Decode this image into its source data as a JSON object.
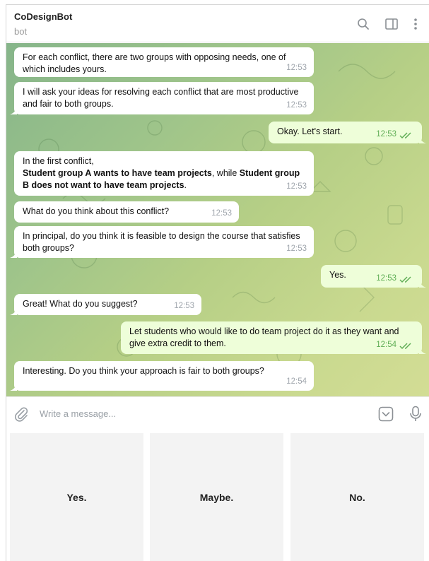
{
  "header": {
    "title": "CoDesignBot",
    "subtitle": "bot",
    "icons": [
      "search-icon",
      "sidebar-toggle-icon",
      "more-icon"
    ]
  },
  "messages": [
    {
      "dir": "in",
      "text": "For each conflict, there are two groups with opposing needs, one of which includes yours.",
      "time": "12:53"
    },
    {
      "dir": "in",
      "text": "I will ask your ideas for resolving each conflict that are most productive and fair to both groups.",
      "time": "12:53"
    },
    {
      "dir": "out",
      "text": "Okay. Let's start.",
      "time": "12:53",
      "read": true
    },
    {
      "dir": "in",
      "parts": {
        "intro": "In the first conflict,",
        "a": "Student group A wants to have team projects",
        "mid": ", while ",
        "b": "Student group B does not want to have team projects",
        "end": "."
      },
      "time": "12:53"
    },
    {
      "dir": "in",
      "text": "What do you think about this conflict?",
      "time": "12:53"
    },
    {
      "dir": "in",
      "text": "In principal, do you think it is feasible to design the course that satisfies both groups?",
      "time": "12:53"
    },
    {
      "dir": "out",
      "text": "Yes.",
      "time": "12:53",
      "read": true
    },
    {
      "dir": "in",
      "text": "Great! What do you suggest?",
      "time": "12:53"
    },
    {
      "dir": "out",
      "text": "Let students who would like to do team project do it as they want and give extra credit to them.",
      "time": "12:54",
      "read": true
    },
    {
      "dir": "in",
      "text": "Interesting. Do you think your approach is fair to both groups?",
      "time": "12:54"
    }
  ],
  "composer": {
    "placeholder": "Write a message...",
    "icons": [
      "attach-icon",
      "keyboard-toggle-icon",
      "microphone-icon"
    ]
  },
  "reply_keyboard": {
    "buttons": [
      "Yes.",
      "Maybe.",
      "No."
    ]
  },
  "colors": {
    "incoming_bubble": "#ffffff",
    "outgoing_bubble": "#eefed9",
    "outgoing_time": "#5fae55",
    "incoming_time": "#a0a6ad",
    "keyboard_button": "#f3f3f3"
  }
}
